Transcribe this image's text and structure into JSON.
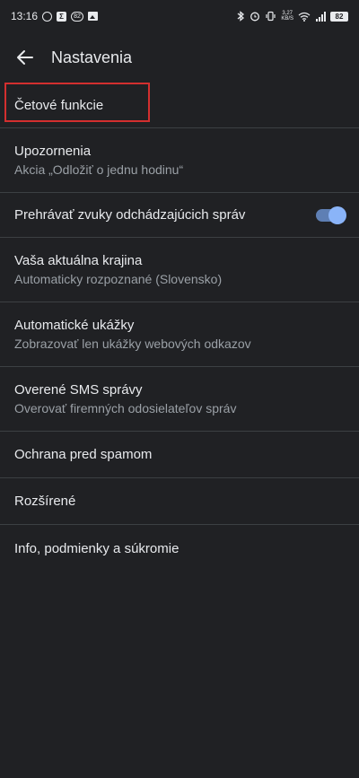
{
  "status_bar": {
    "time": "13:16",
    "badge_count": "82",
    "speed_value": "3,27",
    "speed_unit": "KB/S",
    "battery": "82"
  },
  "app_bar": {
    "title": "Nastavenia"
  },
  "settings": {
    "chat_features": {
      "title": "Četové funkcie"
    },
    "notifications": {
      "title": "Upozornenia",
      "subtitle": "Akcia „Odložiť o jednu hodinu“"
    },
    "outgoing_sounds": {
      "title": "Prehrávať zvuky odchádzajúcich správ",
      "enabled": true
    },
    "country": {
      "title": "Vaša aktuálna krajina",
      "subtitle": "Automaticky rozpoznané (Slovensko)"
    },
    "previews": {
      "title": "Automatické ukážky",
      "subtitle": "Zobrazovať len ukážky webových odkazov"
    },
    "verified_sms": {
      "title": "Overené SMS správy",
      "subtitle": "Overovať firemných odosielateľov správ"
    },
    "spam_protection": {
      "title": "Ochrana pred spamom"
    },
    "advanced": {
      "title": "Rozšírené"
    },
    "about": {
      "title": "Info, podmienky a súkromie"
    }
  },
  "colors": {
    "background": "#202124",
    "divider": "#3c4043",
    "highlight": "#d32f2f",
    "toggle_on": "#8ab4f8"
  }
}
